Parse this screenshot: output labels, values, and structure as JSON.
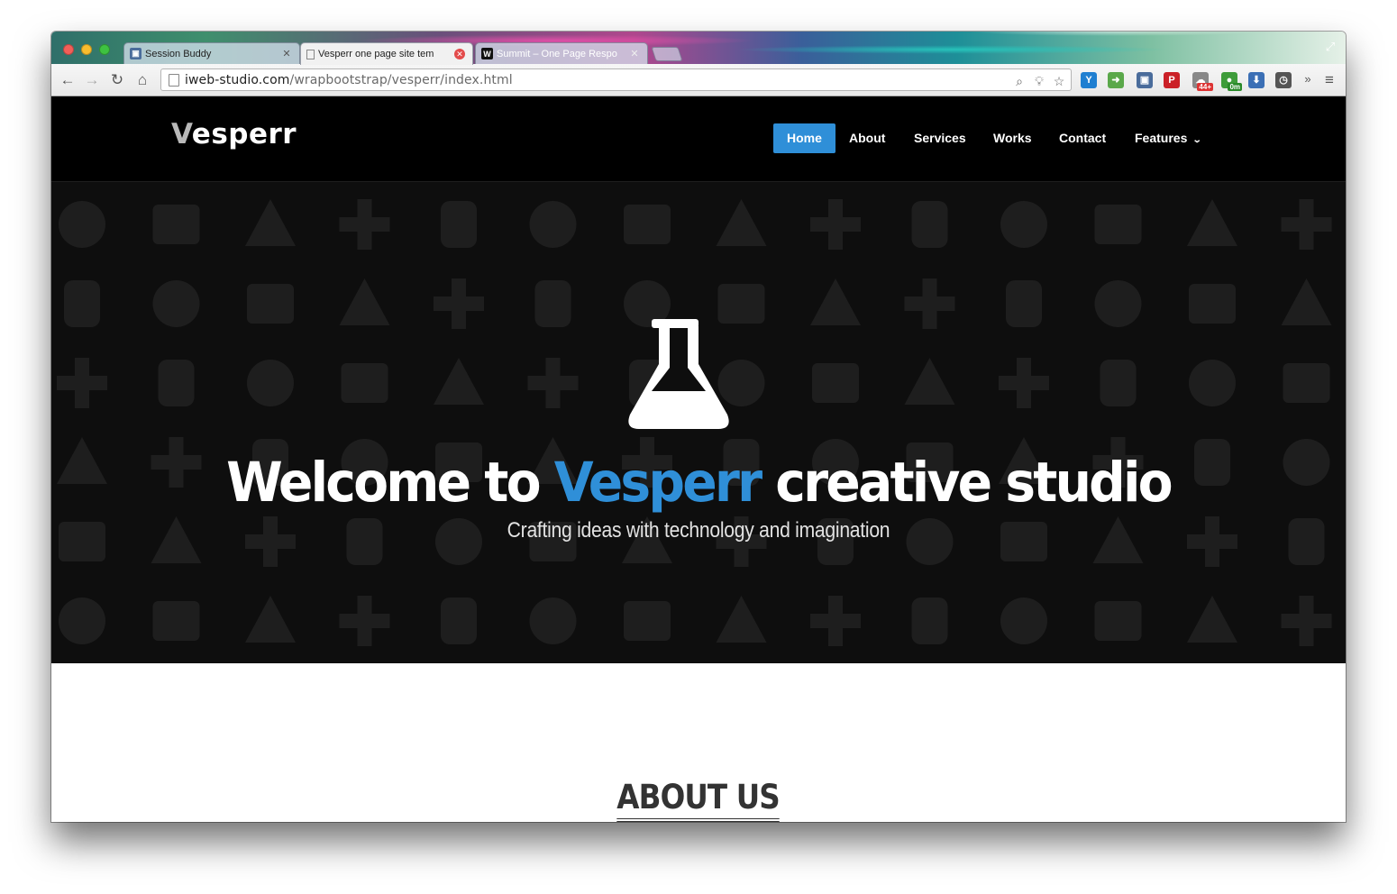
{
  "browser": {
    "tabs": [
      {
        "title": "Session Buddy",
        "active": false
      },
      {
        "title": "Vesperr one page site tem",
        "active": true
      },
      {
        "title": "Summit – One Page Respo",
        "active": false
      }
    ],
    "url_host": "iweb-studio.com",
    "url_path": "/wrapbootstrap/vesperr/index.html",
    "extensions": [
      {
        "name": "instapaper-icon",
        "label": "Y",
        "color": "#1f7fd1"
      },
      {
        "name": "forward-icon",
        "label": "➜",
        "color": "#5aa84a"
      },
      {
        "name": "session-buddy-icon",
        "label": "▣",
        "color": "#4a6c9b"
      },
      {
        "name": "pinterest-icon",
        "label": "P",
        "color": "#cb2027"
      },
      {
        "name": "cloud-icon",
        "label": "☁",
        "color": "#888888",
        "badge": "44+"
      },
      {
        "name": "color-wheel-icon",
        "label": "●",
        "color": "#3e9c3a",
        "badge": "0m"
      },
      {
        "name": "download-icon",
        "label": "⬇",
        "color": "#3b6fb5"
      },
      {
        "name": "history-icon",
        "label": "◷",
        "color": "#555555"
      }
    ]
  },
  "site": {
    "logo_first": "V",
    "logo_rest": "esperr",
    "menu": [
      {
        "label": "Home",
        "active": true
      },
      {
        "label": "About",
        "active": false
      },
      {
        "label": "Services",
        "active": false
      },
      {
        "label": "Works",
        "active": false
      },
      {
        "label": "Contact",
        "active": false
      },
      {
        "label": "Features",
        "active": false,
        "dropdown": true
      }
    ],
    "hero": {
      "title_before": "Welcome to ",
      "title_accent": "Vesperr",
      "title_after": " creative studio",
      "subtitle": "Crafting ideas with technology and imagination"
    },
    "about_title": "ABOUT US"
  },
  "colors": {
    "accent": "#2f8fd8",
    "header_bg": "#000000",
    "hero_bg": "#0e0e0e",
    "icon_pattern": "#1e1e1e"
  }
}
